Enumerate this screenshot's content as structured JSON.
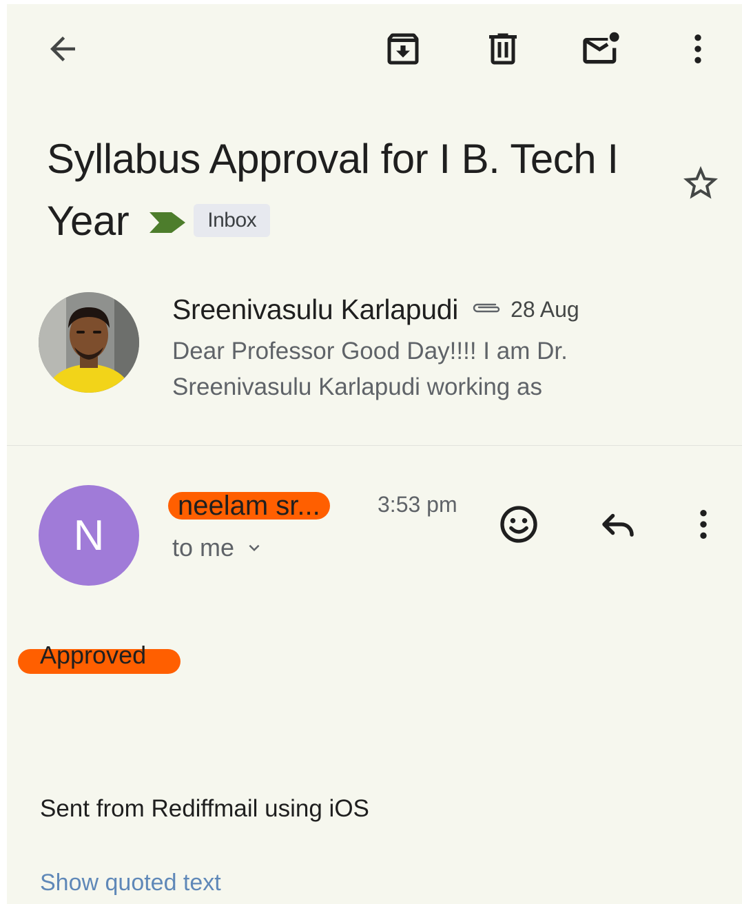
{
  "toolbar": {
    "back_icon": "arrow-left-icon",
    "archive_icon": "archive-icon",
    "delete_icon": "trash-icon",
    "mark_unread_icon": "mail-unread-icon",
    "more_icon": "more-vert-icon"
  },
  "email": {
    "subject": "Syllabus Approval for I B. Tech I Year",
    "label": "Inbox",
    "important_marker": true,
    "starred": false
  },
  "thread": {
    "collapsed_message": {
      "sender": "Sreenivasulu Karlapudi",
      "has_attachment": true,
      "date": "28 Aug",
      "snippet": "Dear Professor Good Day!!!! I am Dr. Sreenivasulu Karlapudi working as"
    },
    "open_message": {
      "avatar_letter": "N",
      "sender": "neelam sr...",
      "time": "3:53 pm",
      "recipient": "to me",
      "body": "Approved",
      "signature": "Sent from Rediffmail using iOS",
      "show_quoted": "Show quoted text"
    }
  },
  "colors": {
    "background": "#f6f7ee",
    "redaction_highlight": "#ff5f00",
    "avatar_n": "#a07bd8",
    "important_marker": "#4d7d2c",
    "link": "#5f88b8"
  }
}
